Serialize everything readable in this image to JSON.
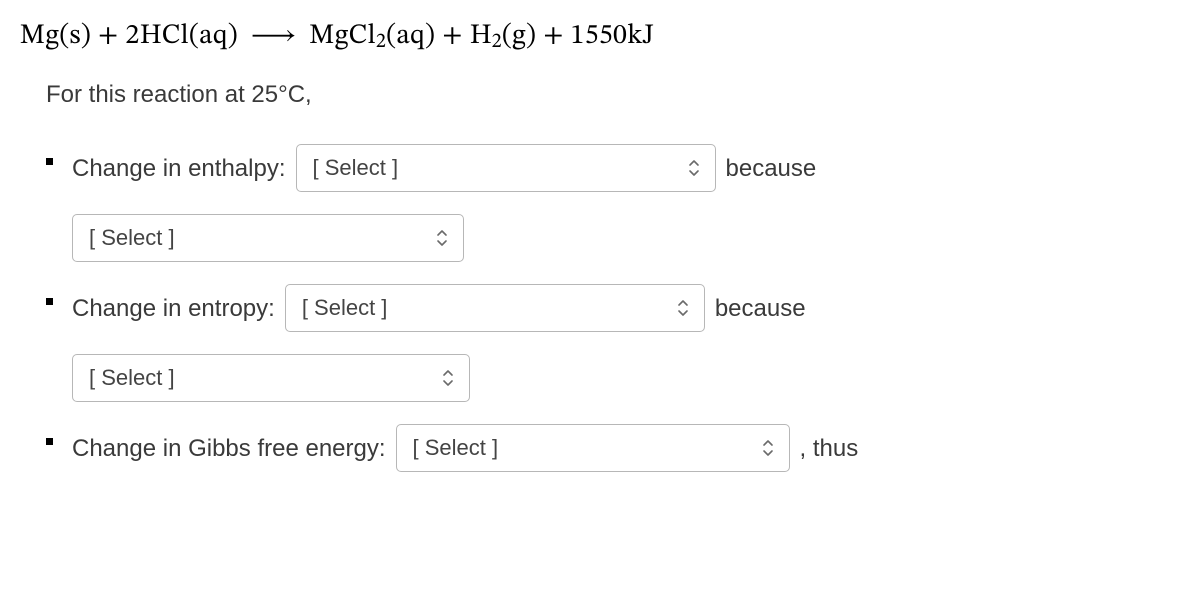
{
  "equation_parts": {
    "lhs_a": "Mg(s) + 2HCl(aq)",
    "arrow": "⟶",
    "rhs_a": "MgCl",
    "rhs_a_sub": "2",
    "rhs_b": "(aq) + H",
    "rhs_b_sub": "2",
    "rhs_c": "(g) + 1550kJ"
  },
  "intro": "For this reaction at 25°C,",
  "items": [
    {
      "label": "Change in enthalpy:",
      "select1_placeholder": "[ Select ]",
      "after1": "because",
      "select2_placeholder": "[ Select ]"
    },
    {
      "label": "Change in entropy:",
      "select1_placeholder": "[ Select ]",
      "after1": "because",
      "select2_placeholder": "[ Select ]"
    },
    {
      "label": "Change in Gibbs free energy:",
      "select1_placeholder": "[ Select ]",
      "after1": ", thus"
    }
  ]
}
